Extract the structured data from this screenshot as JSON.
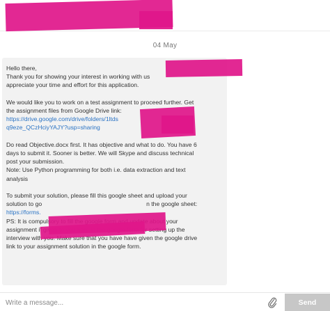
{
  "header": {
    "contact_name": ""
  },
  "date_separator": "04 May",
  "message": {
    "greeting": "Hello there,",
    "intro_1": "Thank you for showing your interest in working with us",
    "intro_2": "appreciate your time and effort for this application.",
    "assign_1": "We would like you to work on a test assignment to proceed further. Get",
    "assign_2": "the assignment files from Google Drive link:",
    "drive_link_1": "https://drive.google.com/drive/folders/1ltds",
    "drive_link_2": "q9eze_QCzHciyYAJY?usp=sharing",
    "read_1": "Do read Objective.docx first. It has objective and what to do. You have 6",
    "read_2": "days to submit it. Sooner is better. We will Skype and discuss technical",
    "read_3": "post your submission.",
    "note_1": "Note: Use Python programming for both i.e. data extraction and text",
    "note_2": "analysis",
    "submit_1": "To submit your solution, please fill this google sheet and upload your",
    "submit_2a": "solution to go",
    "submit_2b": "n the google sheet:",
    "form_link": "https://forms.",
    "ps_1a": "PS: It is compulsory to fill the google form and update about your",
    "ps_2": "assignment if given to you here in the google form for setting up the",
    "ps_3": "interview with you. Make sure that you have have given the google drive",
    "ps_4": "link to your assignment solution in the google form."
  },
  "composer": {
    "placeholder": "Write a message...",
    "value": "",
    "send_label": "Send"
  },
  "colors": {
    "redaction": "#e0168a",
    "link": "#2a73c4",
    "bubble": "#f2f2f2",
    "send_button": "#c7c7c7"
  },
  "icons": {
    "attach": "paperclip-icon"
  }
}
